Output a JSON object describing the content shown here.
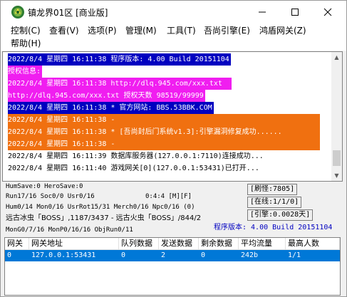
{
  "window": {
    "title": "镇龙界01区 [商业版]",
    "min_label": "—",
    "max_label": "☐",
    "close_label": "✕"
  },
  "menu": [
    "控制(C)",
    "查看(V)",
    "选项(P)",
    "管理(M)",
    "工具(T)",
    "吾尚引擎(E)",
    "鸿盾网关(Z)",
    "帮助(H)"
  ],
  "colors": {
    "blue_highlight": "#0000c0",
    "magenta_highlight": "#f01ef0",
    "orange_highlight": "#f07010",
    "selection_blue": "#0078d7"
  },
  "log": [
    {
      "text": "2022/8/4 星期四 16:11:38 程序版本: 4.00 Build 20151104",
      "fg": "#ffffff",
      "bg": "#0000c0"
    },
    {
      "text": "授权信息:",
      "fg": "#ffffff",
      "bg": "#f01ef0"
    },
    {
      "text": "2022/8/4 星期四 16:11:38 http://dlq.945.com/xxx.txt",
      "fg": "#ffffff",
      "bg": "#f01ef0"
    },
    {
      "text": "http://dlq.945.com/xxx.txt 授权天数 98519/99999",
      "fg": "#ffffff",
      "bg": "#f01ef0"
    },
    {
      "text": "2022/8/4 星期四 16:11:38 * 官方网站: BBS.53BBK.COM",
      "fg": "#ffffff",
      "bg": "#0000c0"
    },
    {
      "text": "2022/8/4 星期四 16:11:38 -",
      "fg": "#ffffff",
      "bg": "#f07010"
    },
    {
      "text": "2022/8/4 星期四 16:11:38 * [吾尚封后门系统v1.3]:引擎漏洞修复成功......",
      "fg": "#ffffff",
      "bg": "#f07010"
    },
    {
      "text": "2022/8/4 星期四 16:11:38 -",
      "fg": "#ffffff",
      "bg": "#f07010"
    },
    {
      "text": "2022/8/4 星期四 16:11:39 数据库服务器(127.0.0.1:7110)连接成功...",
      "fg": "#000000",
      "bg": ""
    },
    {
      "text": "2022/8/4 星期四 16:11:40 游戏网关[0](127.0.0.1:53431)已打开...",
      "fg": "#000000",
      "bg": ""
    }
  ],
  "status": {
    "line1": "HumSave:0 HeroSave:0",
    "line2": "Run17/16 Soc0/0 Usr0/16",
    "line2_mid": "0:4:4 [M][F]",
    "line3": "Hum0/14 Mon0/16 UsrRot15/31 Merch0/16 Npc0/16 (0)",
    "line4": "远古冰虫「BOSS」,1187/3437 - 远古火虫「BOSS」/844/2",
    "line5": "MonG0/7/16 MonP0/16/16 ObjRun0/11",
    "refresh": "[刷怪:7805]",
    "online": "[在线:1/1/0]",
    "engine": "[引擎:0.0028天]",
    "version": "程序版本: 4.00 Build 20151104"
  },
  "gateway": {
    "headers": [
      "网关",
      "网关地址",
      "队列数据",
      "发送数据",
      "剩余数据",
      "平均流量",
      "最高人数"
    ],
    "rows": [
      [
        "0",
        "127.0.0.1:53431",
        "0",
        "2",
        "0",
        "242b",
        "1/1"
      ]
    ]
  }
}
